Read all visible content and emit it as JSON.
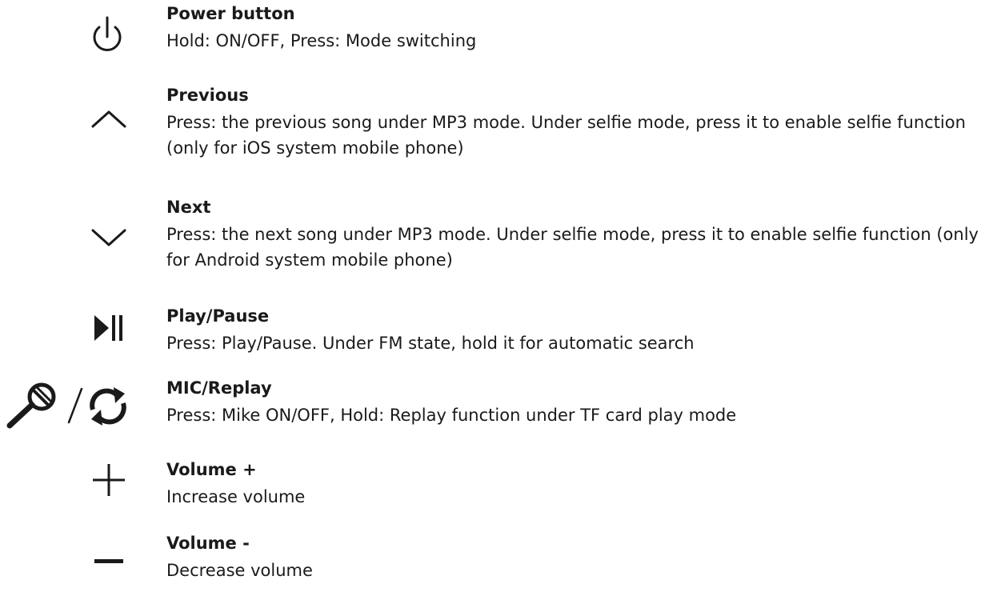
{
  "colors": {
    "text": "#1a1a1a",
    "icon": "#1a1a1a",
    "background": "#ffffff"
  },
  "items": [
    {
      "icon": "power-icon",
      "title": "Power button",
      "description": "Hold: ON/OFF, Press: Mode switching"
    },
    {
      "icon": "chevron-up-icon",
      "title": "Previous",
      "description": "Press: the previous song under MP3 mode. Under selfie mode, press it to enable selfie function (only for iOS system mobile phone)"
    },
    {
      "icon": "chevron-down-icon",
      "title": "Next",
      "description": "Press: the next song under MP3 mode. Under selfie mode, press it to enable selfie function (only for Android system mobile phone)"
    },
    {
      "icon": "play-pause-icon",
      "title": "Play/Pause",
      "description": "Press: Play/Pause. Under FM state, hold it for automatic search"
    },
    {
      "icon": "microphone-replay-icon",
      "title": "MIC/Replay",
      "description": "Press: Mike ON/OFF, Hold: Replay function under TF card play mode"
    },
    {
      "icon": "plus-icon",
      "title": "Volume +",
      "description": "Increase volume"
    },
    {
      "icon": "minus-icon",
      "title": "Volume -",
      "description": "Decrease volume"
    }
  ]
}
